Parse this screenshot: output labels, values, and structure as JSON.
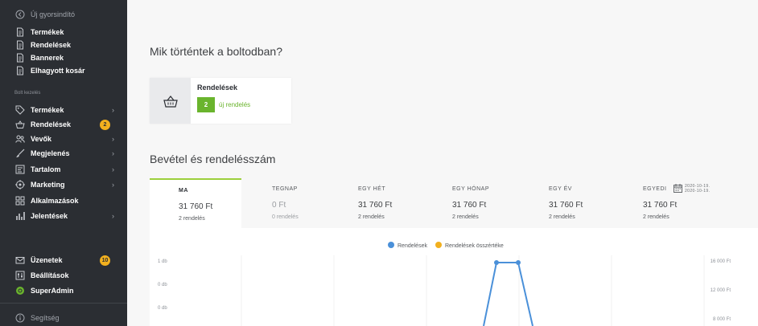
{
  "sidebar": {
    "back": "Új gyorsindító",
    "quick": [
      "Termékek",
      "Rendelések",
      "Bannerek",
      "Elhagyott kosár"
    ],
    "section": "Bolt kezelés",
    "menu": [
      {
        "label": "Termékek",
        "icon": "tag-icon"
      },
      {
        "label": "Rendelések",
        "icon": "basket-icon",
        "badge": "2"
      },
      {
        "label": "Vevők",
        "icon": "users-icon"
      },
      {
        "label": "Megjelenés",
        "icon": "brush-icon"
      },
      {
        "label": "Tartalom",
        "icon": "content-icon"
      },
      {
        "label": "Marketing",
        "icon": "target-icon"
      },
      {
        "label": "Alkalmazások",
        "icon": "apps-icon"
      },
      {
        "label": "Jelentések",
        "icon": "bar-chart-icon"
      }
    ],
    "bottom": [
      {
        "label": "Üzenetek",
        "icon": "mail-icon",
        "badge": "10"
      },
      {
        "label": "Beállítások",
        "icon": "settings-icon"
      },
      {
        "label": "SuperAdmin",
        "icon": "superadmin-icon"
      }
    ],
    "help": "Segítség"
  },
  "main": {
    "title": "Mik történtek a boltodban?",
    "orders_card": {
      "title": "Rendelések",
      "count": "2",
      "count_label": "új rendelés"
    },
    "revenue_title": "Bevétel és rendelésszám",
    "tabs": [
      {
        "label": "MA",
        "value": "31 760 Ft",
        "sub": "2 rendelés"
      },
      {
        "label": "TEGNAP",
        "value": "0 Ft",
        "sub": "0 rendelés"
      },
      {
        "label": "EGY HÉT",
        "value": "31 760 Ft",
        "sub": "2 rendelés"
      },
      {
        "label": "EGY HÓNAP",
        "value": "31 760 Ft",
        "sub": "2 rendelés"
      },
      {
        "label": "EGY ÉV",
        "value": "31 760 Ft",
        "sub": "2 rendelés"
      },
      {
        "label": "EGYEDI",
        "value": "31 760 Ft",
        "sub": "2 rendelés",
        "date_from": "2020-10-19.",
        "date_to": "2020-10-19."
      }
    ]
  },
  "chart_data": {
    "type": "line",
    "legend": [
      "Rendelések",
      "Rendelések összértéke"
    ],
    "legend_placement": "top-center",
    "colors": {
      "orders": "#4a90d9",
      "value": "#f2b01e"
    },
    "y_left_ticks": [
      "1 db",
      "0 db",
      "0 db"
    ],
    "y_right_ticks": [
      "16 000 Ft",
      "12 000 Ft",
      "8 000 Ft"
    ],
    "series": [
      {
        "name": "Rendelések",
        "peak_value": 2
      }
    ]
  }
}
